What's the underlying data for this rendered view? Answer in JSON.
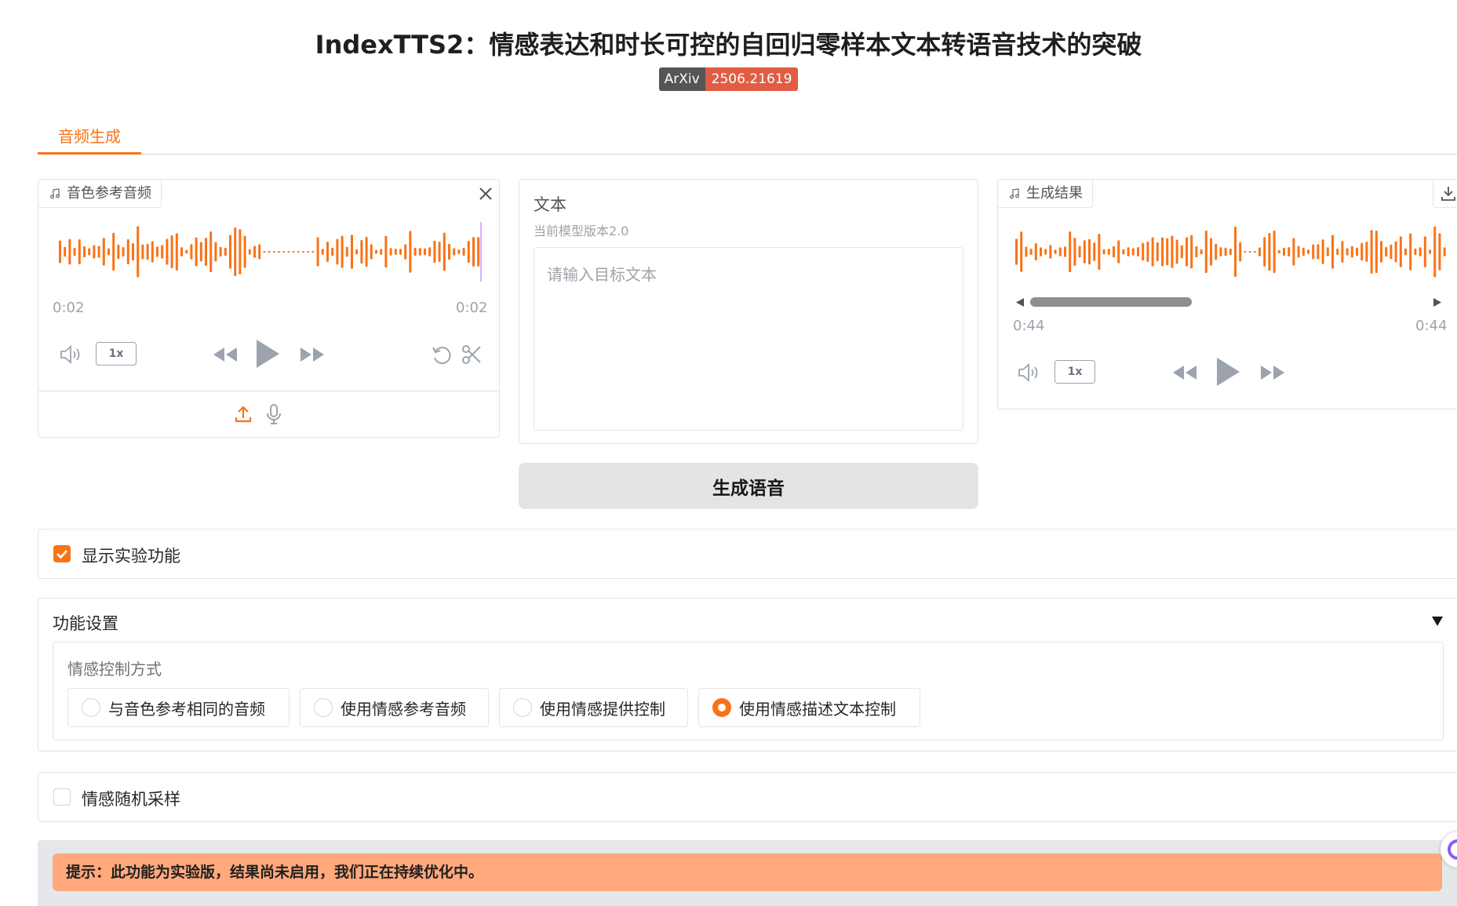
{
  "header": {
    "title": "IndexTTS2：情感表达和时长可控的自回归零样本文本转语音技术的突破",
    "badge_left": "ArXiv",
    "badge_right": "2506.21619"
  },
  "tabs": [
    {
      "label": "音频生成",
      "active": true
    }
  ],
  "reference_audio": {
    "label": "音色参考音频",
    "time_start": "0:02",
    "time_end": "0:02",
    "speed": "1x"
  },
  "text_input": {
    "label": "文本",
    "subtitle": "当前模型版本2.0",
    "placeholder": "请输入目标文本",
    "value": ""
  },
  "result_audio": {
    "label": "生成结果",
    "time_start": "0:44",
    "time_end": "0:44",
    "speed": "1x",
    "scroll_position": 0.45
  },
  "generate_button": {
    "label": "生成语音"
  },
  "experimental": {
    "label": "显示实验功能",
    "checked": true
  },
  "settings": {
    "title": "功能设置",
    "expanded": true,
    "emotion_control": {
      "label": "情感控制方式",
      "options": [
        {
          "label": "与音色参考相同的音频",
          "selected": false
        },
        {
          "label": "使用情感参考音频",
          "selected": false
        },
        {
          "label": "使用情感提供控制",
          "selected": false
        },
        {
          "label": "使用情感描述文本控制",
          "selected": true
        }
      ]
    }
  },
  "random_sampling": {
    "label": "情感随机采样",
    "checked": false
  },
  "hint": {
    "text": "提示：此功能为实验版，结果尚未启用，我们正在持续优化中。"
  },
  "colors": {
    "accent": "#f97316",
    "badge_dark": "#555555",
    "badge_red": "#e05d44",
    "hint_bg": "#ffa97d"
  }
}
